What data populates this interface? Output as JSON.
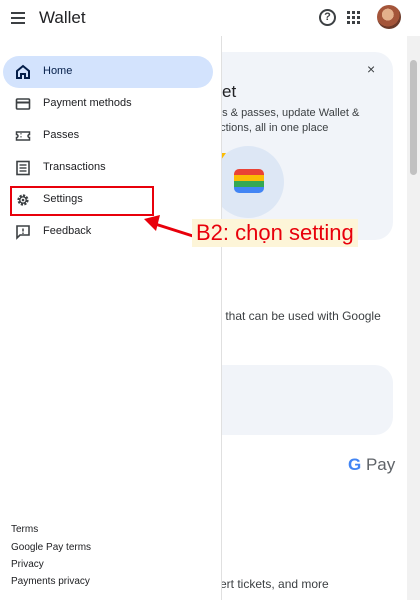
{
  "header": {
    "title": "Wallet",
    "help_icon": "help-circle-icon",
    "apps_icon": "apps-grid-icon"
  },
  "drawer": {
    "items": [
      {
        "label": "Home",
        "icon": "home-icon",
        "active": true
      },
      {
        "label": "Payment methods",
        "icon": "credit-card-icon",
        "active": false
      },
      {
        "label": "Passes",
        "icon": "ticket-icon",
        "active": false
      },
      {
        "label": "Transactions",
        "icon": "receipt-icon",
        "active": false
      },
      {
        "label": "Settings",
        "icon": "gear-icon",
        "active": false
      },
      {
        "label": "Feedback",
        "icon": "feedback-icon",
        "active": false
      }
    ],
    "footer_links": [
      "Terms",
      "Google Pay terms",
      "Privacy",
      "Payments privacy"
    ]
  },
  "background": {
    "card_title": "et",
    "card_line1": "ds & passes, update Wallet &",
    "card_line2": "actions, all in one place",
    "close_label": "×",
    "line3": "s that can be used with Google",
    "gpay_g": "G",
    "gpay_pay": "Pay",
    "line4": "cert tickets, and more"
  },
  "annotation": {
    "text": "B2: chọn setting",
    "color": "#e8000b"
  },
  "colors": {
    "active_nav_bg": "#d3e3fd",
    "accent_blue": "#4285f4"
  }
}
